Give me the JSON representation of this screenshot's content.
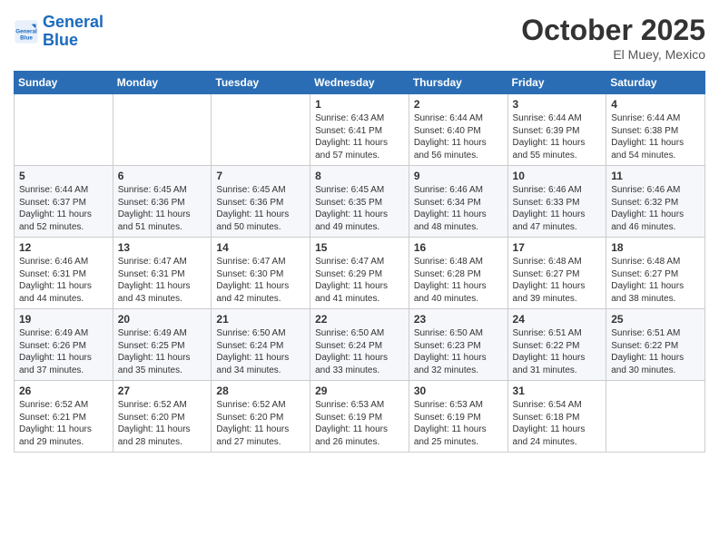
{
  "logo": {
    "line1": "General",
    "line2": "Blue"
  },
  "title": "October 2025",
  "location": "El Muey, Mexico",
  "days_header": [
    "Sunday",
    "Monday",
    "Tuesday",
    "Wednesday",
    "Thursday",
    "Friday",
    "Saturday"
  ],
  "weeks": [
    [
      {
        "day": "",
        "info": ""
      },
      {
        "day": "",
        "info": ""
      },
      {
        "day": "",
        "info": ""
      },
      {
        "day": "1",
        "info": "Sunrise: 6:43 AM\nSunset: 6:41 PM\nDaylight: 11 hours\nand 57 minutes."
      },
      {
        "day": "2",
        "info": "Sunrise: 6:44 AM\nSunset: 6:40 PM\nDaylight: 11 hours\nand 56 minutes."
      },
      {
        "day": "3",
        "info": "Sunrise: 6:44 AM\nSunset: 6:39 PM\nDaylight: 11 hours\nand 55 minutes."
      },
      {
        "day": "4",
        "info": "Sunrise: 6:44 AM\nSunset: 6:38 PM\nDaylight: 11 hours\nand 54 minutes."
      }
    ],
    [
      {
        "day": "5",
        "info": "Sunrise: 6:44 AM\nSunset: 6:37 PM\nDaylight: 11 hours\nand 52 minutes."
      },
      {
        "day": "6",
        "info": "Sunrise: 6:45 AM\nSunset: 6:36 PM\nDaylight: 11 hours\nand 51 minutes."
      },
      {
        "day": "7",
        "info": "Sunrise: 6:45 AM\nSunset: 6:36 PM\nDaylight: 11 hours\nand 50 minutes."
      },
      {
        "day": "8",
        "info": "Sunrise: 6:45 AM\nSunset: 6:35 PM\nDaylight: 11 hours\nand 49 minutes."
      },
      {
        "day": "9",
        "info": "Sunrise: 6:46 AM\nSunset: 6:34 PM\nDaylight: 11 hours\nand 48 minutes."
      },
      {
        "day": "10",
        "info": "Sunrise: 6:46 AM\nSunset: 6:33 PM\nDaylight: 11 hours\nand 47 minutes."
      },
      {
        "day": "11",
        "info": "Sunrise: 6:46 AM\nSunset: 6:32 PM\nDaylight: 11 hours\nand 46 minutes."
      }
    ],
    [
      {
        "day": "12",
        "info": "Sunrise: 6:46 AM\nSunset: 6:31 PM\nDaylight: 11 hours\nand 44 minutes."
      },
      {
        "day": "13",
        "info": "Sunrise: 6:47 AM\nSunset: 6:31 PM\nDaylight: 11 hours\nand 43 minutes."
      },
      {
        "day": "14",
        "info": "Sunrise: 6:47 AM\nSunset: 6:30 PM\nDaylight: 11 hours\nand 42 minutes."
      },
      {
        "day": "15",
        "info": "Sunrise: 6:47 AM\nSunset: 6:29 PM\nDaylight: 11 hours\nand 41 minutes."
      },
      {
        "day": "16",
        "info": "Sunrise: 6:48 AM\nSunset: 6:28 PM\nDaylight: 11 hours\nand 40 minutes."
      },
      {
        "day": "17",
        "info": "Sunrise: 6:48 AM\nSunset: 6:27 PM\nDaylight: 11 hours\nand 39 minutes."
      },
      {
        "day": "18",
        "info": "Sunrise: 6:48 AM\nSunset: 6:27 PM\nDaylight: 11 hours\nand 38 minutes."
      }
    ],
    [
      {
        "day": "19",
        "info": "Sunrise: 6:49 AM\nSunset: 6:26 PM\nDaylight: 11 hours\nand 37 minutes."
      },
      {
        "day": "20",
        "info": "Sunrise: 6:49 AM\nSunset: 6:25 PM\nDaylight: 11 hours\nand 35 minutes."
      },
      {
        "day": "21",
        "info": "Sunrise: 6:50 AM\nSunset: 6:24 PM\nDaylight: 11 hours\nand 34 minutes."
      },
      {
        "day": "22",
        "info": "Sunrise: 6:50 AM\nSunset: 6:24 PM\nDaylight: 11 hours\nand 33 minutes."
      },
      {
        "day": "23",
        "info": "Sunrise: 6:50 AM\nSunset: 6:23 PM\nDaylight: 11 hours\nand 32 minutes."
      },
      {
        "day": "24",
        "info": "Sunrise: 6:51 AM\nSunset: 6:22 PM\nDaylight: 11 hours\nand 31 minutes."
      },
      {
        "day": "25",
        "info": "Sunrise: 6:51 AM\nSunset: 6:22 PM\nDaylight: 11 hours\nand 30 minutes."
      }
    ],
    [
      {
        "day": "26",
        "info": "Sunrise: 6:52 AM\nSunset: 6:21 PM\nDaylight: 11 hours\nand 29 minutes."
      },
      {
        "day": "27",
        "info": "Sunrise: 6:52 AM\nSunset: 6:20 PM\nDaylight: 11 hours\nand 28 minutes."
      },
      {
        "day": "28",
        "info": "Sunrise: 6:52 AM\nSunset: 6:20 PM\nDaylight: 11 hours\nand 27 minutes."
      },
      {
        "day": "29",
        "info": "Sunrise: 6:53 AM\nSunset: 6:19 PM\nDaylight: 11 hours\nand 26 minutes."
      },
      {
        "day": "30",
        "info": "Sunrise: 6:53 AM\nSunset: 6:19 PM\nDaylight: 11 hours\nand 25 minutes."
      },
      {
        "day": "31",
        "info": "Sunrise: 6:54 AM\nSunset: 6:18 PM\nDaylight: 11 hours\nand 24 minutes."
      },
      {
        "day": "",
        "info": ""
      }
    ]
  ]
}
